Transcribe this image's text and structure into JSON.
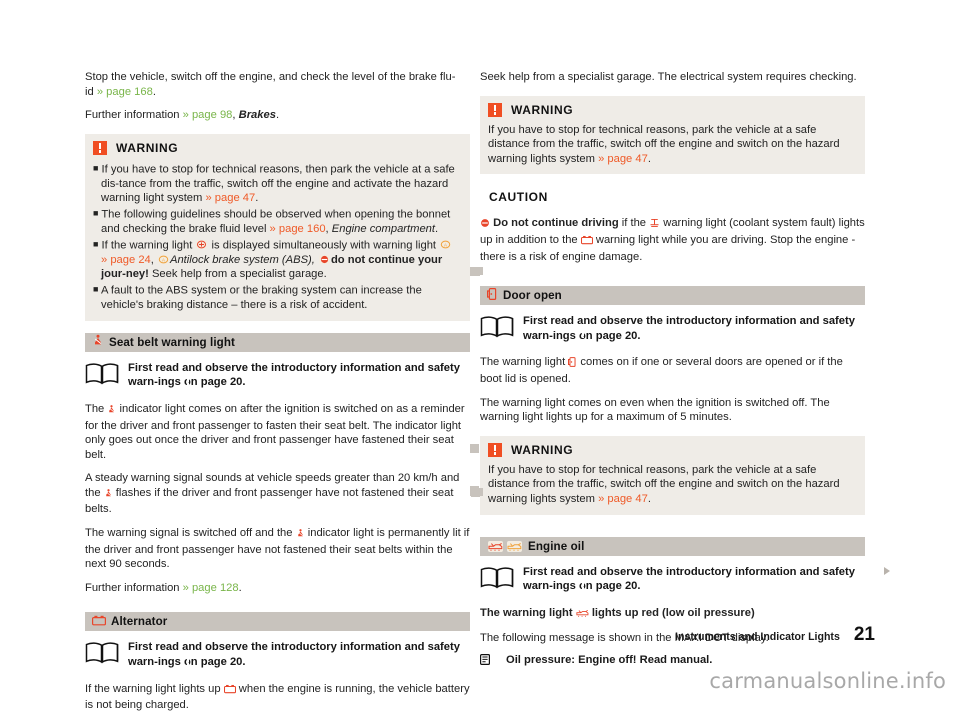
{
  "document": {
    "footer_title": "Instruments and Indicator Lights",
    "page_number": "21",
    "watermark": "carmanualsonline.info"
  },
  "colors": {
    "warning_orange": "#f04e23",
    "caution_yellow": "#fbd440",
    "section_bar": "#c8c3bd",
    "note_background": "#efece7",
    "page_ref_green": "#79b54a",
    "page_ref_orange": "#ef5a28"
  },
  "labels": {
    "warning": "WARNING",
    "caution": "CAUTION"
  },
  "left_column": {
    "intro_para_1_a": "Stop the vehicle, switch off the engine, and check the level of the brake flu-",
    "intro_para_1_b": "id ",
    "intro_para_1_ref": "» page 168",
    "intro_para_1_end": ".",
    "intro_para_2_a": "Further information ",
    "intro_para_2_ref": "» page 98",
    "intro_para_2_b": ", ",
    "intro_para_2_ital": "Brakes",
    "intro_para_2_end": ".",
    "warning_box": {
      "bullet_1_a": "If you have to stop for technical reasons, then park the vehicle at a safe dis-tance from the traffic, switch off the engine and activate the hazard warning light system ",
      "bullet_1_ref": "» page 47",
      "bullet_1_end": ".",
      "bullet_2_a": "The following guidelines should be observed when opening the bonnet and checking the brake fluid level ",
      "bullet_2_ref": "» page 160",
      "bullet_2_b": ", ",
      "bullet_2_ital": "Engine compartment",
      "bullet_2_end": ".",
      "bullet_3_a": "If the warning light ",
      "bullet_3_b": " is displayed simultaneously with warning light",
      "bullet_3_ref": "» page 24",
      "bullet_3_c": ", ",
      "bullet_3_ital": "Antilock brake system (ABS),",
      "bullet_3_bold": "do not continue your jour-ney!",
      "bullet_3_end": " Seek help from a specialist garage.",
      "bullet_4": "A fault to the ABS system or the braking system can increase the vehicle's braking distance – there is a risk of accident."
    },
    "seat_belt": {
      "title": "Seat belt warning light",
      "icon": "seatbelt-icon",
      "read_first_a": "First read and observe the introductory information and safety warn-ings ",
      "read_first_b": " on page 20.",
      "para_1_a": "The ",
      "para_1_b": " indicator light comes on after the ignition is switched on as a reminder for the driver and front passenger to fasten their seat belt. The indicator light only goes out once the driver and front passenger have fastened their seat belt.",
      "para_2_a": "A steady warning signal sounds at vehicle speeds greater than 20 km/h and the ",
      "para_2_b": " flashes if the driver and front passenger have not fastened their seat belts.",
      "para_3_a": "The warning signal is switched off and the ",
      "para_3_b": " indicator light is permanently lit if the driver and front passenger have not fastened their seat belts within the next 90 seconds.",
      "para_4_a": "Further information ",
      "para_4_ref": "» page 128",
      "para_4_end": "."
    },
    "alternator": {
      "title": "Alternator",
      "icon": "battery-icon",
      "read_first_a": "First read and observe the introductory information and safety warn-ings ",
      "read_first_b": " on page 20.",
      "para_1_a": "If the warning light lights up ",
      "para_1_b": " when the engine is running, the vehicle battery is not being charged."
    }
  },
  "right_column": {
    "intro_para": "Seek help from a specialist garage. The electrical system requires checking.",
    "warning_box_1": {
      "text_a": "If you have to stop for technical reasons, park the vehicle at a safe distance from the traffic, switch off the engine and switch on the hazard warning lights system ",
      "text_ref": "» page 47",
      "text_end": "."
    },
    "caution_box": {
      "bold_lead": "Do not continue driving",
      "text_a": " if the ",
      "text_b": " warning light (coolant system fault) lights up in addition to the ",
      "text_c": " warning light while you are driving. Stop the engine - there is a risk of engine damage."
    },
    "door_open": {
      "title": "Door open",
      "icon": "door-open-icon",
      "read_first_a": "First read and observe the introductory information and safety warn-ings ",
      "read_first_b": " on page 20.",
      "para_1_a": "The warning light ",
      "para_1_b": " comes on if one or several doors are opened or if the boot lid is opened.",
      "para_2": "The warning light comes on even when the ignition is switched off. The warning light lights up for a maximum of 5 minutes."
    },
    "warning_box_2": {
      "text_a": "If you have to stop for technical reasons, park the vehicle at a safe distance from the traffic, switch off the engine and switch on the hazard warning lights system ",
      "text_ref": "» page 47",
      "text_end": "."
    },
    "engine_oil": {
      "title": "Engine oil",
      "icon_1": "oil-can-red-icon",
      "icon_2": "oil-can-yellow-icon",
      "read_first_a": "First read and observe the introductory information and safety warn-ings ",
      "read_first_b": " on page 20.",
      "para_1_a": "The warning light ",
      "para_1_b": " lights up red (low oil pressure)",
      "para_2": "The following message is shown in the MAXI DOT display.",
      "message": "Oil pressure: Engine off! Read manual."
    }
  }
}
